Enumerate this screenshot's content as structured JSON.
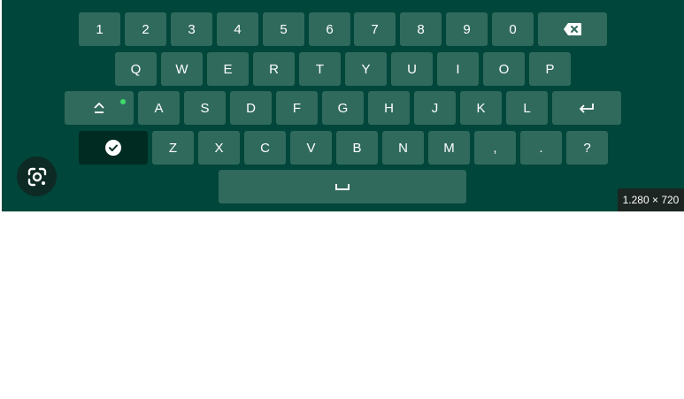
{
  "keyboard": {
    "row1": [
      "1",
      "2",
      "3",
      "4",
      "5",
      "6",
      "7",
      "8",
      "9",
      "0"
    ],
    "row2": [
      "Q",
      "W",
      "E",
      "R",
      "T",
      "Y",
      "U",
      "I",
      "O",
      "P"
    ],
    "row3": [
      "A",
      "S",
      "D",
      "F",
      "G",
      "H",
      "J",
      "K",
      "L"
    ],
    "row4": [
      "Z",
      "X",
      "C",
      "V",
      "B",
      "N",
      "M",
      ",",
      ".",
      "?"
    ],
    "icons": {
      "backspace": "backspace-icon",
      "shift": "shift-icon",
      "enter": "enter-icon",
      "check": "check-icon",
      "space": "space-icon",
      "lens": "google-lens-icon"
    },
    "colors": {
      "background": "#00463a",
      "key": "#306a5d",
      "key_dark": "#002b22",
      "shift_indicator": "#3ddc6a"
    }
  },
  "image_info": {
    "dimensions_label": "1.280 × 720"
  }
}
